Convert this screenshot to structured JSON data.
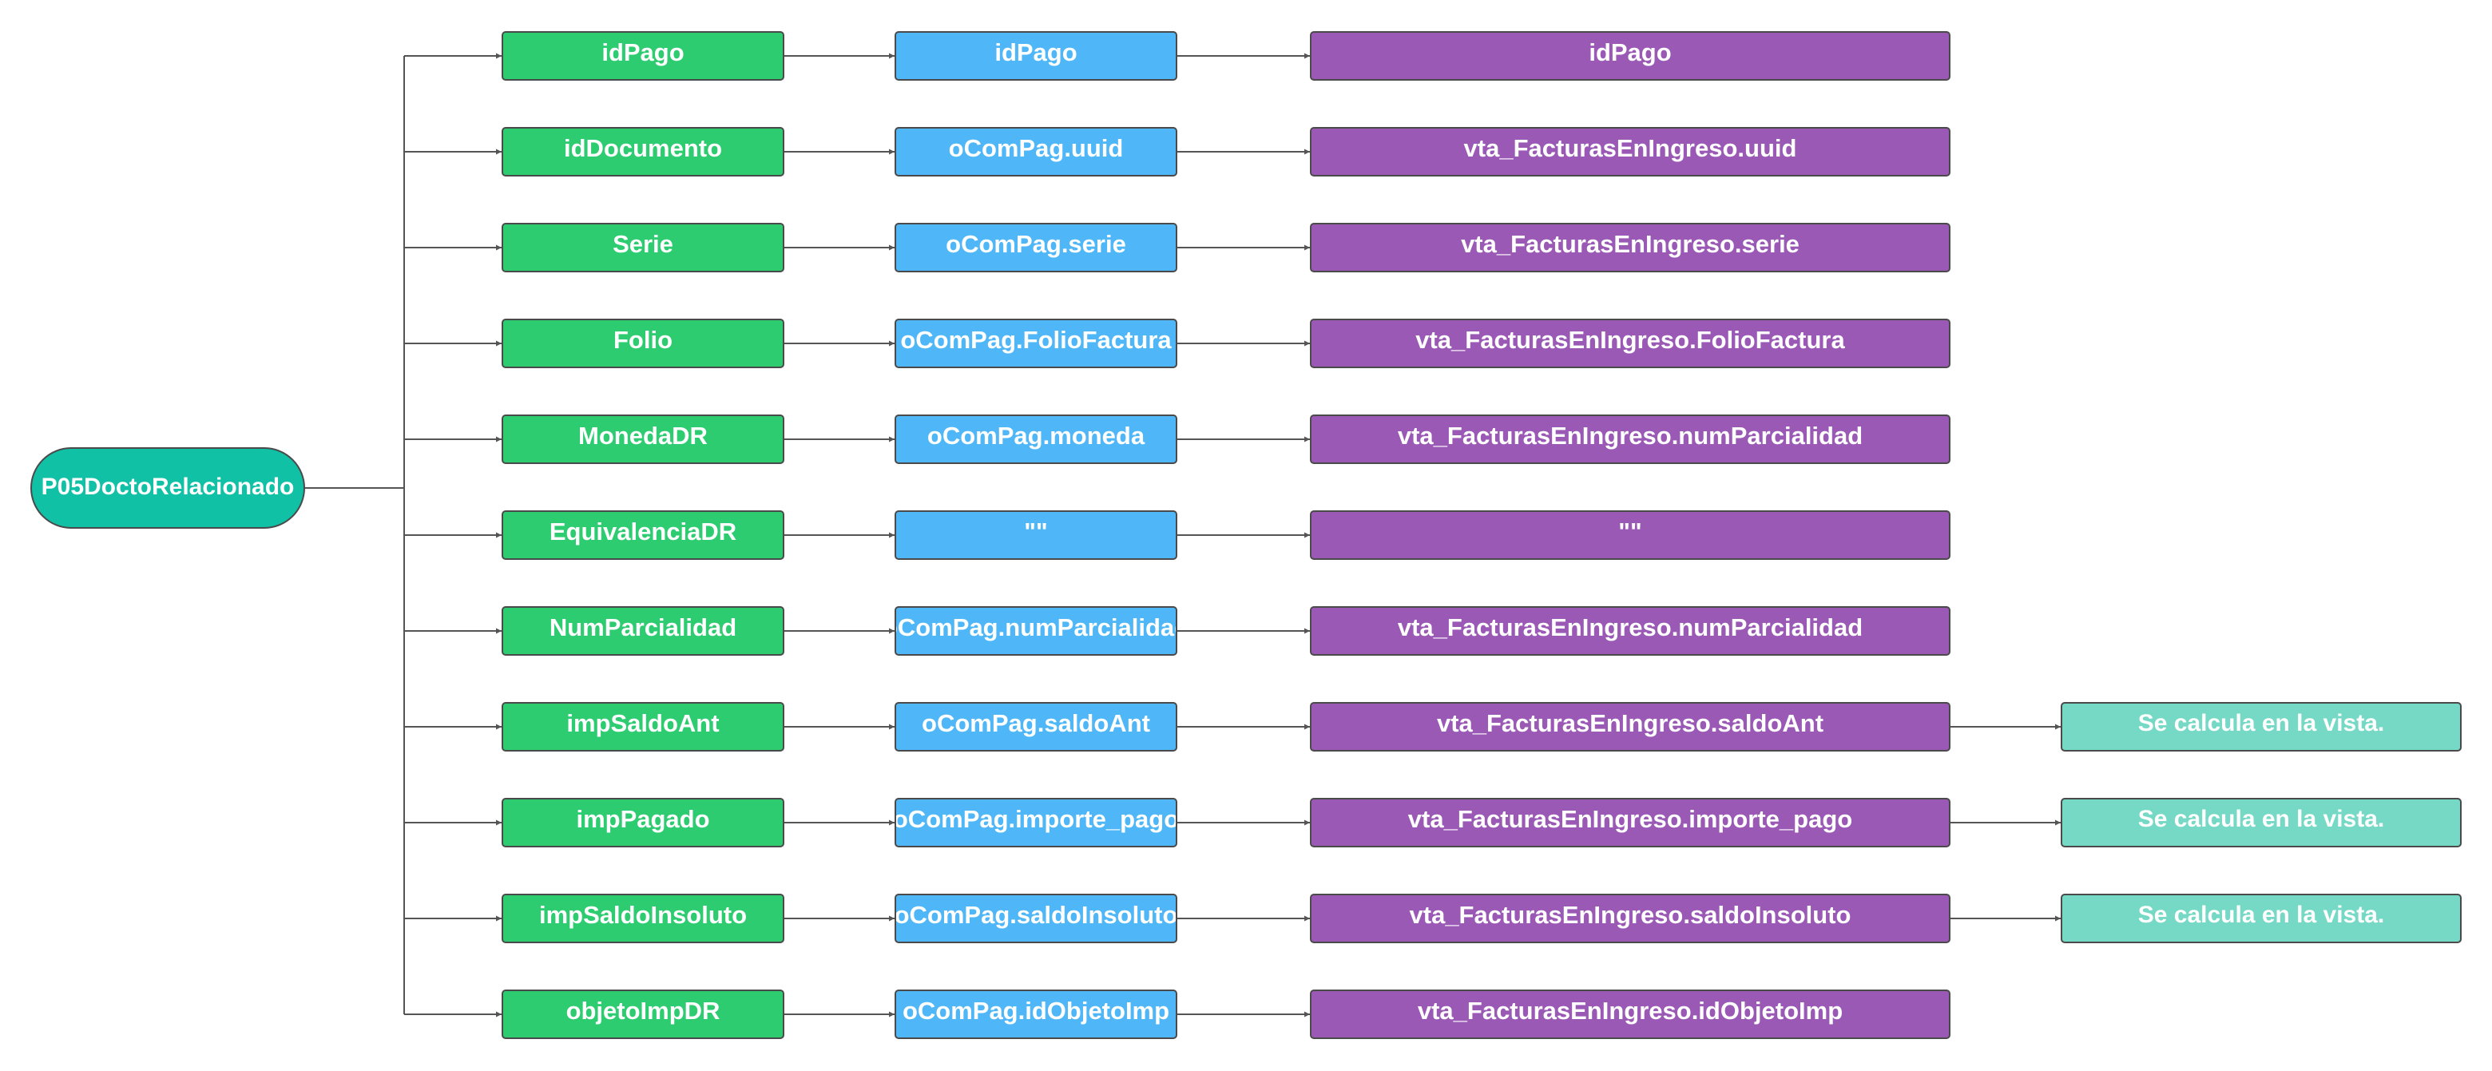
{
  "root": {
    "label": "P05DoctoRelacionado"
  },
  "rows": [
    {
      "field": "idPago",
      "source": "idPago",
      "view": "idPago",
      "note": ""
    },
    {
      "field": "idDocumento",
      "source": "oComPag.uuid",
      "view": "vta_FacturasEnIngreso.uuid",
      "note": ""
    },
    {
      "field": "Serie",
      "source": "oComPag.serie",
      "view": "vta_FacturasEnIngreso.serie",
      "note": ""
    },
    {
      "field": "Folio",
      "source": "oComPag.FolioFactura",
      "view": "vta_FacturasEnIngreso.FolioFactura",
      "note": ""
    },
    {
      "field": "MonedaDR",
      "source": "oComPag.moneda",
      "view": "vta_FacturasEnIngreso.numParcialidad",
      "note": ""
    },
    {
      "field": "EquivalenciaDR",
      "source": "\"\"",
      "view": "\"\"",
      "note": ""
    },
    {
      "field": "NumParcialidad",
      "source": "oComPag.numParcialidad",
      "view": "vta_FacturasEnIngreso.numParcialidad",
      "note": ""
    },
    {
      "field": "impSaldoAnt",
      "source": "oComPag.saldoAnt",
      "view": "vta_FacturasEnIngreso.saldoAnt",
      "note": "Se calcula en la vista."
    },
    {
      "field": "impPagado",
      "source": "oComPag.importe_pago",
      "view": "vta_FacturasEnIngreso.importe_pago",
      "note": "Se calcula en la vista."
    },
    {
      "field": "impSaldoInsoluto",
      "source": "oComPag.saldoInsoluto",
      "view": "vta_FacturasEnIngreso.saldoInsoluto",
      "note": "Se calcula en la vista."
    },
    {
      "field": "objetoImpDR",
      "source": "oComPag.idObjetoImp",
      "view": "vta_FacturasEnIngreso.idObjetoImp",
      "note": ""
    }
  ],
  "colors": {
    "root": "#10c1a6",
    "field": "#2ecc71",
    "source": "#4fb7f7",
    "view": "#9b59b6",
    "note": "#76d9c5",
    "connector": "#555555"
  }
}
